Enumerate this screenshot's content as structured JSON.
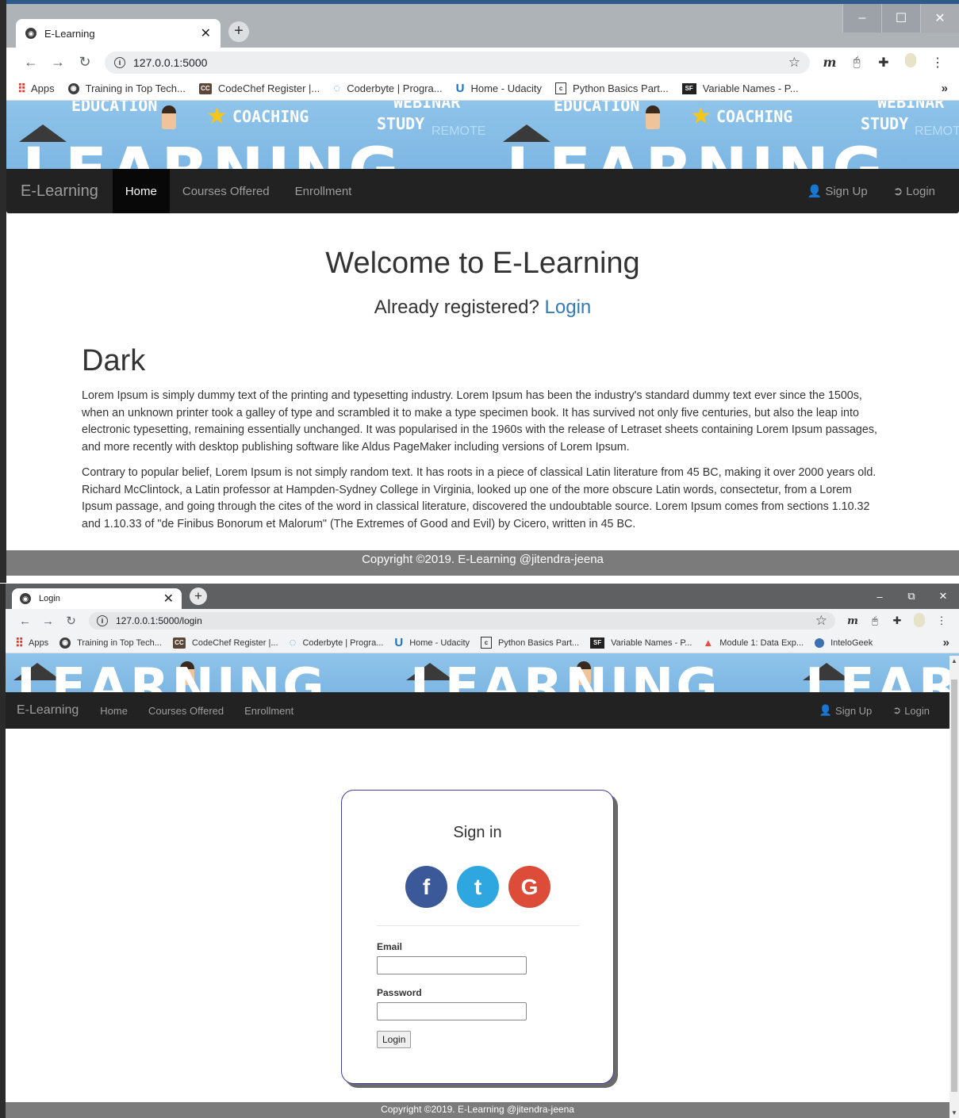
{
  "screens": [
    {
      "tab_title": "E-Learning",
      "url": "127.0.0.1:5000",
      "window_controls": [
        "–",
        "☐",
        "✕"
      ],
      "bookmarks": [
        "Apps",
        "Training in Top Tech...",
        "CodeChef Register |...",
        "Coderbyte | Progra...",
        "Home - Udacity",
        "Python Basics Part...",
        "Variable Names - P..."
      ],
      "banner": {
        "words": [
          "EDUCATION",
          "COACHING",
          "WEBINAR",
          "STUDY",
          "REMOTE",
          "LEARNING"
        ]
      },
      "navbar": {
        "brand": "E-Learning",
        "links": [
          "Home",
          "Courses Offered",
          "Enrollment"
        ],
        "active": "Home",
        "right_links": [
          "Sign Up",
          "Login"
        ]
      },
      "content": {
        "welcome": "Welcome to E-Learning",
        "already_text": "Already registered?",
        "already_link": "Login",
        "heading": "Dark",
        "paragraphs": [
          "Lorem Ipsum is simply dummy text of the printing and typesetting industry. Lorem Ipsum has been the industry's standard dummy text ever since the 1500s, when an unknown printer took a galley of type and scrambled it to make a type specimen book. It has survived not only five centuries, but also the leap into electronic typesetting, remaining essentially unchanged. It was popularised in the 1960s with the release of Letraset sheets containing Lorem Ipsum passages, and more recently with desktop publishing software like Aldus PageMaker including versions of Lorem Ipsum.",
          "Contrary to popular belief, Lorem Ipsum is not simply random text. It has roots in a piece of classical Latin literature from 45 BC, making it over 2000 years old. Richard McClintock, a Latin professor at Hampden-Sydney College in Virginia, looked up one of the more obscure Latin words, consectetur, from a Lorem Ipsum passage, and going through the cites of the word in classical literature, discovered the undoubtable source. Lorem Ipsum comes from sections 1.10.32 and 1.10.33 of \"de Finibus Bonorum et Malorum\" (The Extremes of Good and Evil) by Cicero, written in 45 BC."
        ]
      },
      "footer": "Copyright ©2019. E-Learning @jitendra-jeena"
    },
    {
      "tab_title": "Login",
      "url": "127.0.0.1:5000/login",
      "window_controls": [
        "–",
        "⧉",
        "✕"
      ],
      "bookmarks": [
        "Apps",
        "Training in Top Tech...",
        "CodeChef Register |...",
        "Coderbyte | Progra...",
        "Home - Udacity",
        "Python Basics Part...",
        "Variable Names - P...",
        "Module 1: Data Exp...",
        "InteloGeek"
      ],
      "banner": {
        "words": [
          "LEARNING"
        ]
      },
      "navbar": {
        "brand": "E-Learning",
        "links": [
          "Home",
          "Courses Offered",
          "Enrollment"
        ],
        "right_links": [
          "Sign Up",
          "Login"
        ]
      },
      "login_card": {
        "title": "Sign in",
        "social": [
          "f",
          "t",
          "G"
        ],
        "email_label": "Email",
        "password_label": "Password",
        "submit": "Login"
      },
      "footer": "Copyright ©2019. E-Learning @jitendra-jeena"
    }
  ],
  "colors": {
    "navbar": "#222222",
    "link": "#337ab7",
    "footer": "#7b7b7b",
    "facebook": "#3b5998",
    "twitter": "#2ea7e0",
    "google": "#dd4b39"
  },
  "icons": {
    "user": "user-icon",
    "login": "login-icon",
    "star": "star-icon",
    "extensions": "puzzle-icon"
  }
}
